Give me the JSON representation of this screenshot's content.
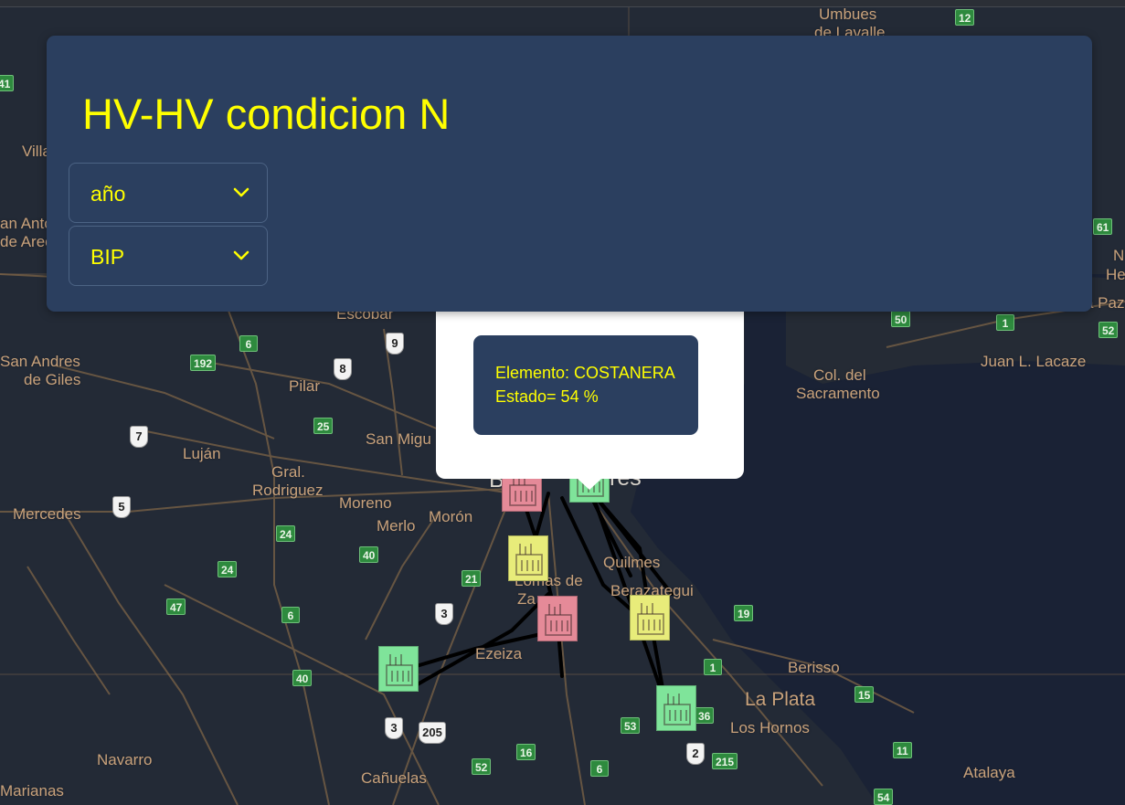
{
  "panel": {
    "title": "HV-HV condicion N",
    "selects": [
      {
        "label": "año"
      },
      {
        "label": "BIP"
      }
    ]
  },
  "popup": {
    "line1": "Elemento: COSTANERA",
    "line2": "Estado= 54 %"
  },
  "map": {
    "places": [
      "Umbues",
      "de Lavalle",
      "Villa",
      "an Anto",
      "de Areco",
      "Escobar",
      "San Andres",
      "de Giles",
      "Pilar",
      "San Migu",
      "Luján",
      "Gral.",
      "Rodriguez",
      "Moreno",
      "Mercedes",
      "Merlo",
      "Morón",
      "Quilmes",
      "Lomas de",
      "Za",
      "Berazategui",
      "Ezeiza",
      "Berisso",
      "La Plata",
      "Los Hornos",
      "Navarro",
      "Cañuelas",
      "Marianas",
      "Atalaya",
      "Col. del",
      "Sacramento",
      "Juan L. Lacaze",
      "N",
      "He",
      "a Paz",
      "Bue",
      "res"
    ],
    "route_shields": [
      "12",
      "41",
      "61",
      "52",
      "50",
      "1",
      "192",
      "6",
      "9",
      "8",
      "25",
      "7",
      "5",
      "24",
      "40",
      "24",
      "21",
      "47",
      "6",
      "3",
      "19",
      "1",
      "40",
      "15",
      "3",
      "205",
      "53",
      "36",
      "2",
      "215",
      "11",
      "52",
      "16",
      "6",
      "54"
    ],
    "plants": [
      {
        "status": "red"
      },
      {
        "status": "green"
      },
      {
        "status": "yellow"
      },
      {
        "status": "red"
      },
      {
        "status": "yellow"
      },
      {
        "status": "green"
      },
      {
        "status": "green"
      }
    ],
    "colors": {
      "plant_red": "#e58a98",
      "plant_green": "#7fe49a",
      "plant_yellow": "#e8ec7a",
      "panel_bg": "#2b3f5f",
      "accent_text": "#ffff00"
    }
  }
}
